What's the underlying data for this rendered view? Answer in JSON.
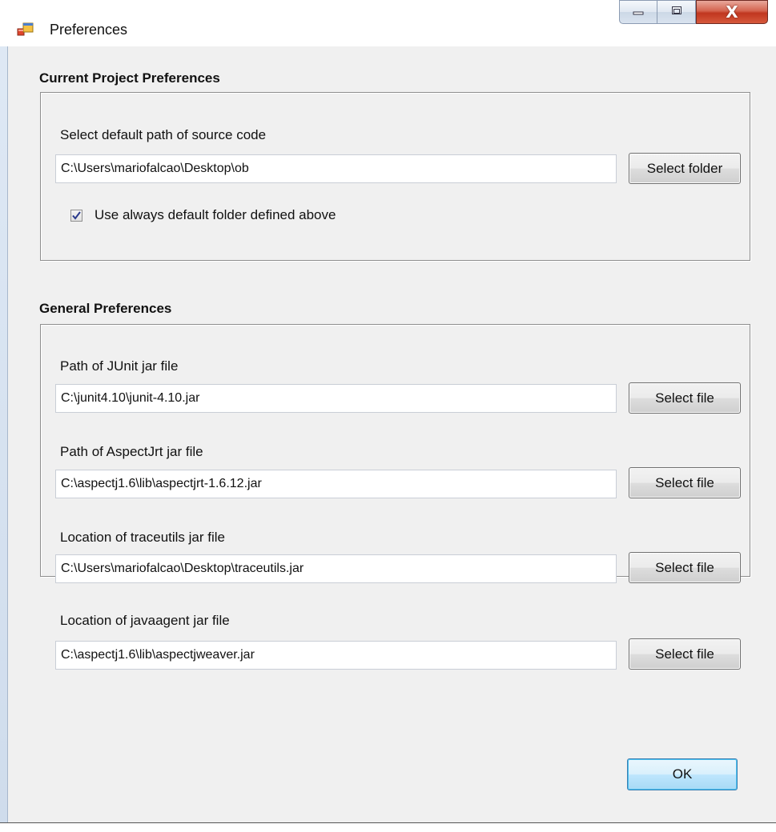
{
  "window": {
    "title": "Preferences",
    "minimize_icon": "minimize-icon",
    "maximize_icon": "maximize-icon",
    "close_icon": "close-icon",
    "close_glyph": "X"
  },
  "current_project": {
    "title": "Current Project Preferences",
    "source_label": "Select default path of source code",
    "source_value": "C:\\Users\\mariofalcao\\Desktop\\ob",
    "select_folder_label": "Select folder",
    "checkbox_label": "Use always default folder defined above",
    "checkbox_checked": true
  },
  "general": {
    "title": "General Preferences",
    "junit_label": "Path of JUnit jar file",
    "junit_value": "C:\\junit4.10\\junit-4.10.jar",
    "aspectjrt_label": "Path of AspectJrt jar file",
    "aspectjrt_value": "C:\\aspectj1.6\\lib\\aspectjrt-1.6.12.jar",
    "traceutils_label": "Location of traceutils jar file",
    "traceutils_value": "C:\\Users\\mariofalcao\\Desktop\\traceutils.jar",
    "javaagent_label": "Location of javaagent jar file",
    "javaagent_value": "C:\\aspectj1.6\\lib\\aspectjweaver.jar",
    "select_file_label": "Select file"
  },
  "ok_label": "OK",
  "colors": {
    "dialog_bg": "#f0f0f0",
    "ok_border": "#3c7fb1",
    "close_button": "#c0361f"
  }
}
